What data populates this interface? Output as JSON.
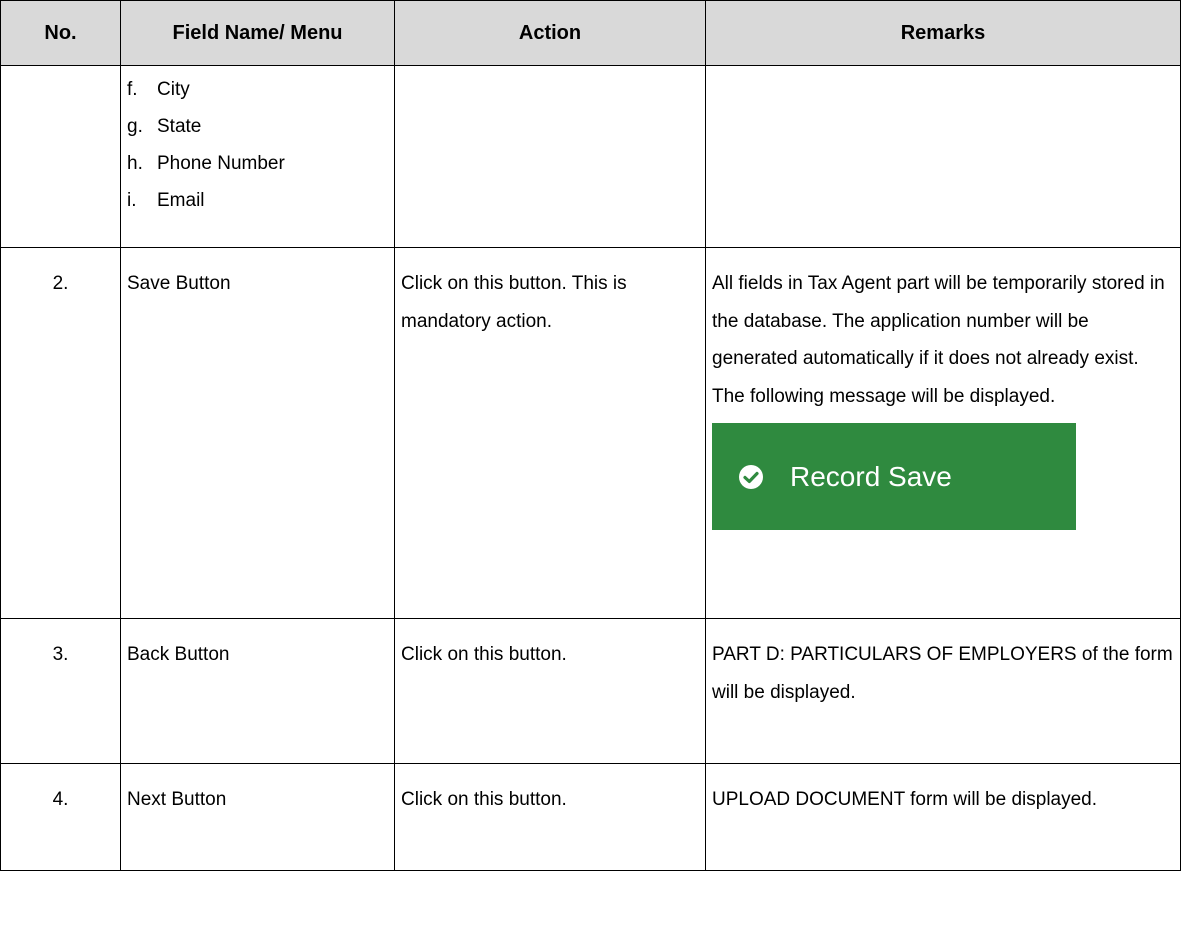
{
  "table": {
    "headers": {
      "no": "No.",
      "field": "Field Name/ Menu",
      "action": "Action",
      "remarks": "Remarks"
    },
    "continued_items": [
      {
        "letter": "f.",
        "label": "City"
      },
      {
        "letter": "g.",
        "label": "State"
      },
      {
        "letter": "h.",
        "label": "Phone Number"
      },
      {
        "letter": "i.",
        "label": "Email"
      }
    ],
    "rows": [
      {
        "no": "2.",
        "field": "Save Button",
        "action": "Click on this button. This is mandatory action.",
        "remarks": "All fields in Tax Agent part will be temporarily stored in the database. The application number will be generated automatically if it does not already exist. The following message will be displayed."
      },
      {
        "no": "3.",
        "field": "Back Button",
        "action": "Click on this button.",
        "remarks": "PART D: PARTICULARS OF EMPLOYERS of the form will be displayed."
      },
      {
        "no": "4.",
        "field": "Next Button",
        "action": "Click on this button.",
        "remarks": "UPLOAD DOCUMENT form will be displayed."
      }
    ]
  },
  "record_save_banner": {
    "text": "Record Save",
    "icon": "check-circle-icon",
    "background_color": "#2f8a3f"
  }
}
